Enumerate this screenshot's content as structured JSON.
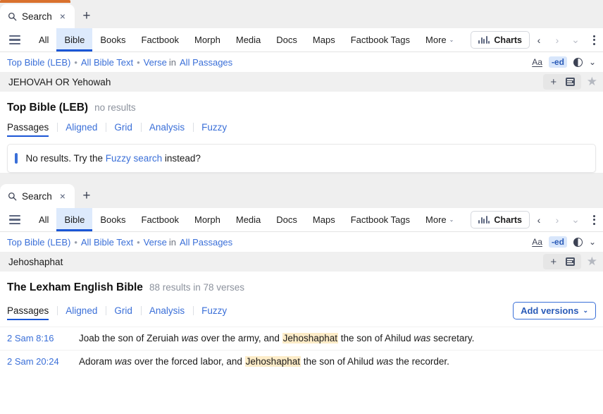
{
  "colors": {
    "accent_orange": "#d9712e",
    "link_blue": "#3a6fd8",
    "active_tab_blue": "#1a56d6",
    "active_tab_bg": "#ddeafc",
    "highlight": "#fdecc8",
    "tabstrip_bg": "#efefef",
    "query_bg": "#f0f0f0"
  },
  "panels": [
    {
      "tab": {
        "icon": "search-icon",
        "label": "Search",
        "close": "×",
        "new_tab": "+"
      },
      "nav": {
        "menu_icon": "hamburger-icon",
        "items": [
          {
            "label": "All",
            "active": false
          },
          {
            "label": "Bible",
            "active": true
          },
          {
            "label": "Books",
            "active": false
          },
          {
            "label": "Factbook",
            "active": false
          },
          {
            "label": "Morph",
            "active": false
          },
          {
            "label": "Media",
            "active": false
          },
          {
            "label": "Docs",
            "active": false
          },
          {
            "label": "Maps",
            "active": false
          },
          {
            "label": "Factbook Tags",
            "active": false
          },
          {
            "label": "More",
            "active": false,
            "caret": "⌄"
          }
        ],
        "charts_label": "Charts",
        "charts_icon": "bar-chart-icon",
        "back_icon": "‹",
        "forward_icon": "›",
        "history_icon": "⌄",
        "kebab_icon": "more-vertical-icon"
      },
      "breadcrumb": {
        "parts": [
          "Top Bible (LEB)",
          "All Bible Text",
          "Verse"
        ],
        "sep": "•",
        "in_word": "in",
        "scope": "All Passages",
        "tools": {
          "font_label": "Aa",
          "ed_label": "-ed",
          "theme_icon": "half-moon-icon",
          "caret": "⌄"
        }
      },
      "query": {
        "value": "JEHOVAH OR Yehowah",
        "placeholder": "Search",
        "add_icon": "+",
        "list_icon": "list-icon",
        "star_icon": "★"
      },
      "results": {
        "title": "Top Bible (LEB)",
        "count": "no results",
        "subtabs": [
          {
            "label": "Passages",
            "active": true
          },
          {
            "label": "Aligned",
            "active": false
          },
          {
            "label": "Grid",
            "active": false
          },
          {
            "label": "Analysis",
            "active": false
          },
          {
            "label": "Fuzzy",
            "active": false
          }
        ],
        "empty_card": {
          "before": "No results. Try the ",
          "link": "Fuzzy search",
          "after": " instead?"
        }
      }
    },
    {
      "tab": {
        "icon": "search-icon",
        "label": "Search",
        "close": "×",
        "new_tab": "+"
      },
      "nav": {
        "menu_icon": "hamburger-icon",
        "items": [
          {
            "label": "All",
            "active": false
          },
          {
            "label": "Bible",
            "active": true
          },
          {
            "label": "Books",
            "active": false
          },
          {
            "label": "Factbook",
            "active": false
          },
          {
            "label": "Morph",
            "active": false
          },
          {
            "label": "Media",
            "active": false
          },
          {
            "label": "Docs",
            "active": false
          },
          {
            "label": "Maps",
            "active": false
          },
          {
            "label": "Factbook Tags",
            "active": false
          },
          {
            "label": "More",
            "active": false,
            "caret": "⌄"
          }
        ],
        "charts_label": "Charts",
        "charts_icon": "bar-chart-icon",
        "back_icon": "‹",
        "forward_icon": "›",
        "history_icon": "⌄",
        "kebab_icon": "more-vertical-icon"
      },
      "breadcrumb": {
        "parts": [
          "Top Bible (LEB)",
          "All Bible Text",
          "Verse"
        ],
        "sep": "•",
        "in_word": "in",
        "scope": "All Passages",
        "tools": {
          "font_label": "Aa",
          "ed_label": "-ed",
          "theme_icon": "half-moon-icon",
          "caret": "⌄"
        }
      },
      "query": {
        "value": "Jehoshaphat",
        "placeholder": "Search",
        "add_icon": "+",
        "list_icon": "list-icon",
        "star_icon": "★"
      },
      "results": {
        "title": "The Lexham English Bible",
        "count": "88 results in 78 verses",
        "subtabs": [
          {
            "label": "Passages",
            "active": true
          },
          {
            "label": "Aligned",
            "active": false
          },
          {
            "label": "Grid",
            "active": false
          },
          {
            "label": "Analysis",
            "active": false
          },
          {
            "label": "Fuzzy",
            "active": false
          }
        ],
        "add_versions_label": "Add versions",
        "add_versions_caret": "⌄",
        "verses": [
          {
            "ref": "2 Sam 8:16",
            "segments": [
              {
                "t": "Joab the son of Zeruiah ",
                "s": "plain"
              },
              {
                "t": "was",
                "s": "italic"
              },
              {
                "t": " over the army, and ",
                "s": "plain"
              },
              {
                "t": "Jehoshaphat",
                "s": "highlight"
              },
              {
                "t": " the son of Ahilud ",
                "s": "plain"
              },
              {
                "t": "was",
                "s": "italic"
              },
              {
                "t": " secretary.",
                "s": "plain"
              }
            ]
          },
          {
            "ref": "2 Sam 20:24",
            "segments": [
              {
                "t": "Adoram ",
                "s": "plain"
              },
              {
                "t": "was",
                "s": "italic"
              },
              {
                "t": " over the forced labor, and ",
                "s": "plain"
              },
              {
                "t": "Jehoshaphat",
                "s": "highlight"
              },
              {
                "t": " the son of Ahilud ",
                "s": "plain"
              },
              {
                "t": "was",
                "s": "italic"
              },
              {
                "t": " the recorder.",
                "s": "plain"
              }
            ]
          }
        ]
      }
    }
  ]
}
